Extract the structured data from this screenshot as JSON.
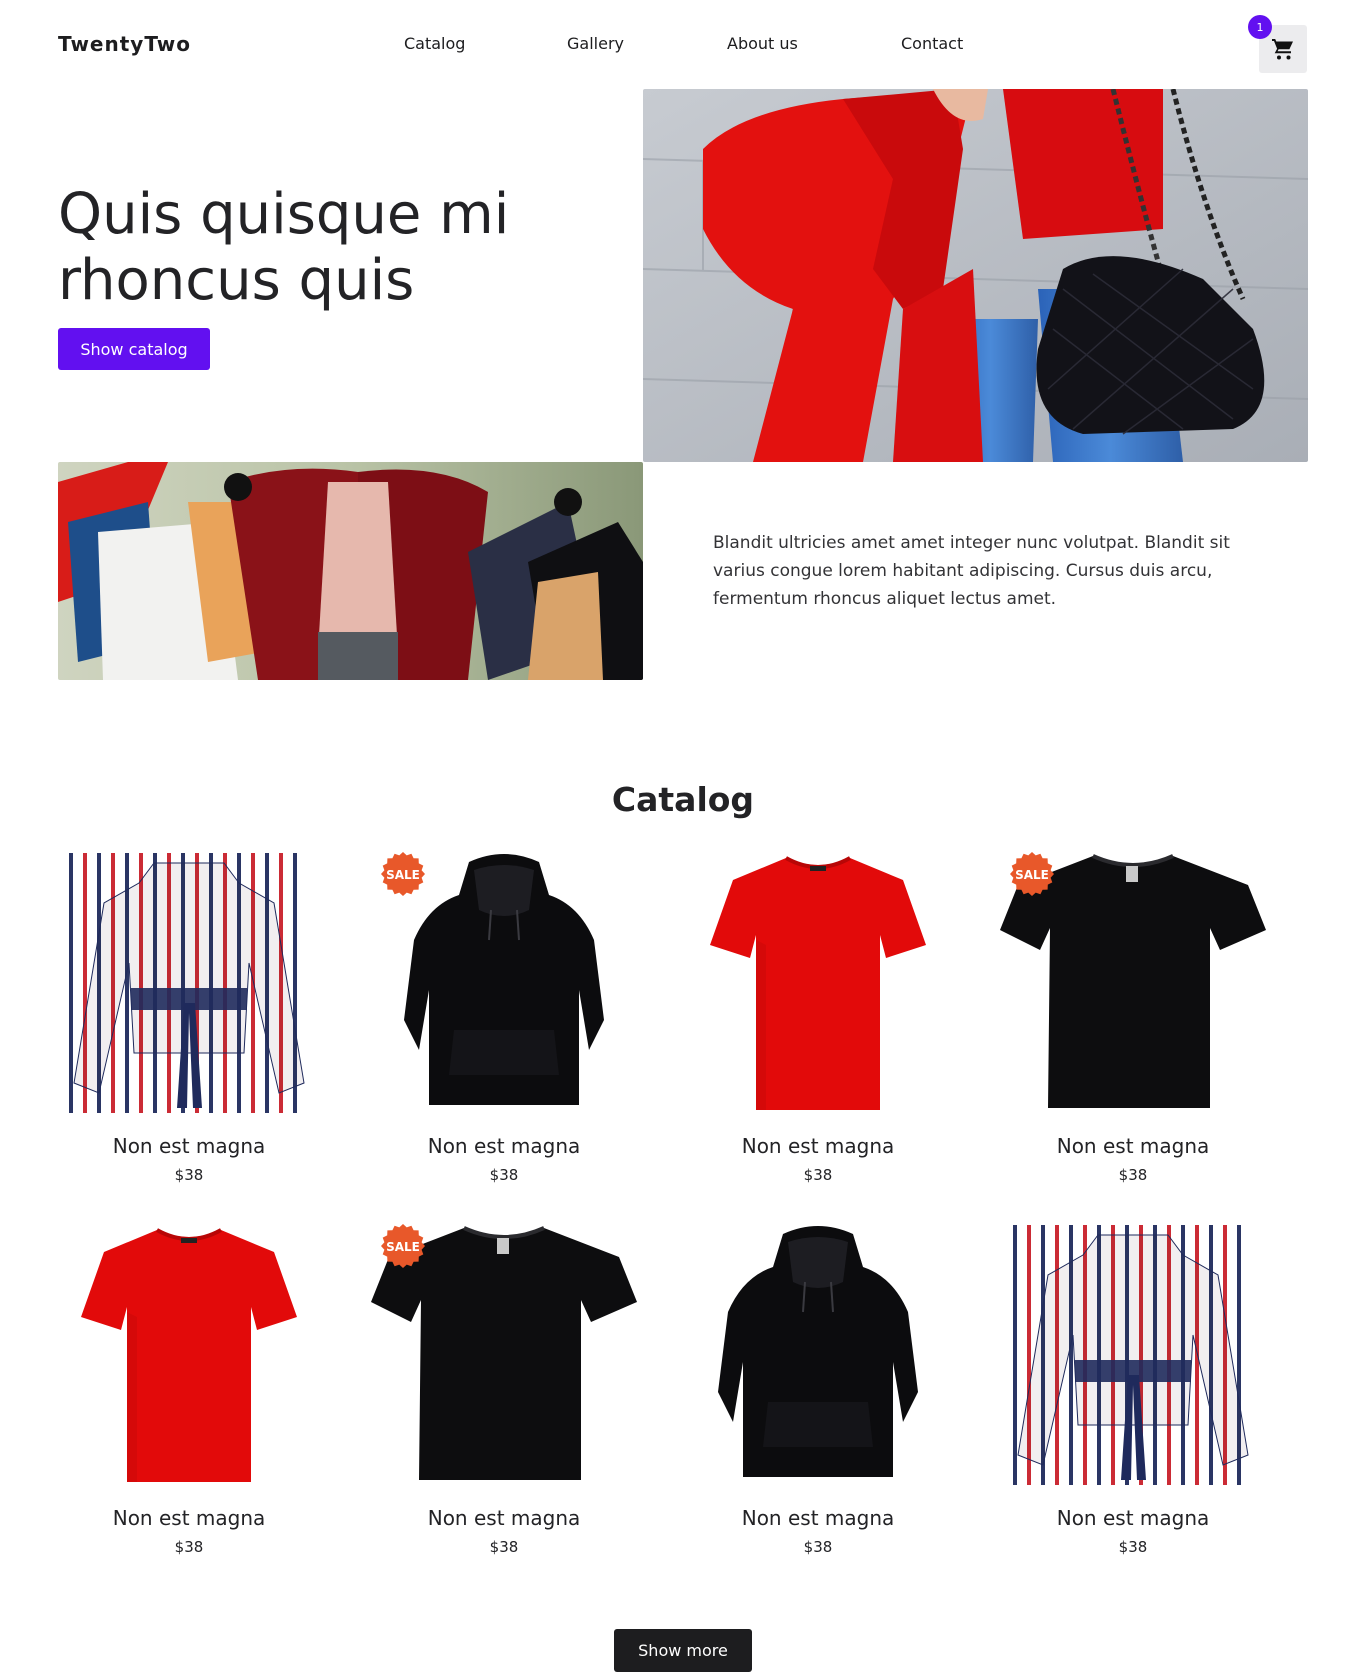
{
  "header": {
    "logo": "TwentyTwo",
    "nav": [
      "Catalog",
      "Gallery",
      "About us",
      "Contact"
    ],
    "cart_count": "1",
    "cart_icon": "shopping-cart-icon"
  },
  "hero": {
    "title": "Quis quisque mi rhoncus quis",
    "button": "Show catalog",
    "text": "Blandit ultricies amet amet integer nunc volutpat. Blandit sit varius congue lorem habitant adipiscing. Cursus duis arcu, fermentum rhoncus aliquet lectus amet."
  },
  "catalog": {
    "title": "Catalog",
    "sale_label": "SALE",
    "products": [
      {
        "name": "Non est magna",
        "price": "$38",
        "item": "striped-blouse",
        "sale": false
      },
      {
        "name": "Non est magna",
        "price": "$38",
        "item": "black-hoodie",
        "sale": true
      },
      {
        "name": "Non est magna",
        "price": "$38",
        "item": "red-tshirt",
        "sale": false
      },
      {
        "name": "Non est magna",
        "price": "$38",
        "item": "black-tshirt",
        "sale": true
      },
      {
        "name": "Non est magna",
        "price": "$38",
        "item": "red-tshirt",
        "sale": false
      },
      {
        "name": "Non est magna",
        "price": "$38",
        "item": "black-tshirt",
        "sale": true
      },
      {
        "name": "Non est magna",
        "price": "$38",
        "item": "black-hoodie",
        "sale": false
      },
      {
        "name": "Non est magna",
        "price": "$38",
        "item": "striped-blouse",
        "sale": false
      }
    ],
    "more_button": "Show more"
  },
  "colors": {
    "accent": "#6210f0",
    "dark": "#1d1d1f",
    "sale": "#e8582a",
    "red_garment": "#e20a0a"
  }
}
